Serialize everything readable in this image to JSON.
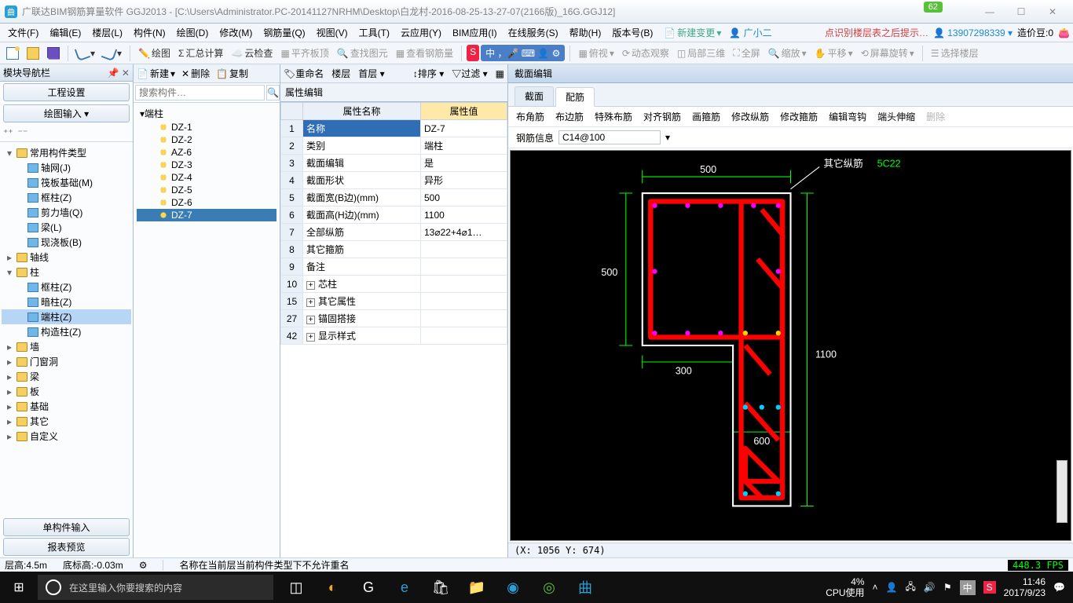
{
  "titlebar": {
    "title": "广联达BIM钢筋算量软件 GGJ2013 - [C:\\Users\\Administrator.PC-20141127NRHM\\Desktop\\白龙村-2016-08-25-13-27-07(2166版)_16G.GGJ12]",
    "badge": "62"
  },
  "menubar": {
    "items": [
      "文件(F)",
      "编辑(E)",
      "楼层(L)",
      "构件(N)",
      "绘图(D)",
      "修改(M)",
      "钢筋量(Q)",
      "视图(V)",
      "工具(T)",
      "云应用(Y)",
      "BIM应用(I)",
      "在线服务(S)",
      "帮助(H)",
      "版本号(B)"
    ],
    "new_change": "新建变更",
    "user_name": "广小二",
    "promo": "点识别楼层表之后提示…",
    "account": "13907298339",
    "credit_label": "造价豆:0"
  },
  "toolbar2": {
    "items": [
      "绘图",
      "汇总计算",
      "云检查",
      "平齐板顶",
      "查找图元",
      "查看钢筋量",
      "",
      "俯视",
      "动态观察",
      "局部三维",
      "全屏",
      "缩放",
      "平移",
      "屏幕旋转",
      "选择楼层"
    ]
  },
  "left_panel": {
    "title": "模块导航栏",
    "tabs": [
      "工程设置",
      "绘图输入"
    ],
    "tree": [
      {
        "l": 1,
        "exp": "▾",
        "ico": "folder",
        "label": "常用构件类型"
      },
      {
        "l": 2,
        "ico": "item",
        "label": "轴网(J)"
      },
      {
        "l": 2,
        "ico": "item",
        "label": "筏板基础(M)"
      },
      {
        "l": 2,
        "ico": "item",
        "label": "框柱(Z)"
      },
      {
        "l": 2,
        "ico": "item",
        "label": "剪力墙(Q)"
      },
      {
        "l": 2,
        "ico": "item",
        "label": "梁(L)"
      },
      {
        "l": 2,
        "ico": "item",
        "label": "现浇板(B)"
      },
      {
        "l": 1,
        "exp": "▸",
        "ico": "folder",
        "label": "轴线"
      },
      {
        "l": 1,
        "exp": "▾",
        "ico": "folder",
        "label": "柱"
      },
      {
        "l": 2,
        "ico": "item",
        "label": "框柱(Z)"
      },
      {
        "l": 2,
        "ico": "item",
        "label": "暗柱(Z)"
      },
      {
        "l": 2,
        "ico": "item",
        "label": "端柱(Z)",
        "selected": true
      },
      {
        "l": 2,
        "ico": "item",
        "label": "构造柱(Z)"
      },
      {
        "l": 1,
        "exp": "▸",
        "ico": "folder",
        "label": "墙"
      },
      {
        "l": 1,
        "exp": "▸",
        "ico": "folder",
        "label": "门窗洞"
      },
      {
        "l": 1,
        "exp": "▸",
        "ico": "folder",
        "label": "梁"
      },
      {
        "l": 1,
        "exp": "▸",
        "ico": "folder",
        "label": "板"
      },
      {
        "l": 1,
        "exp": "▸",
        "ico": "folder",
        "label": "基础"
      },
      {
        "l": 1,
        "exp": "▸",
        "ico": "folder",
        "label": "其它"
      },
      {
        "l": 1,
        "exp": "▸",
        "ico": "folder",
        "label": "自定义"
      }
    ],
    "bottom_tabs": [
      "单构件输入",
      "报表预览"
    ]
  },
  "mid_panel": {
    "toolbar": [
      "新建",
      "删除",
      "复制",
      "重命名",
      "楼层",
      "首层"
    ],
    "search_placeholder": "搜索构件…",
    "tree": [
      {
        "l": 1,
        "exp": "▾",
        "label": "端柱"
      },
      {
        "l": 2,
        "label": "DZ-1"
      },
      {
        "l": 2,
        "label": "DZ-2"
      },
      {
        "l": 2,
        "label": "AZ-6"
      },
      {
        "l": 2,
        "label": "DZ-3"
      },
      {
        "l": 2,
        "label": "DZ-4"
      },
      {
        "l": 2,
        "label": "DZ-5"
      },
      {
        "l": 2,
        "label": "DZ-6"
      },
      {
        "l": 2,
        "label": "DZ-7",
        "selected": true
      }
    ]
  },
  "prop_panel": {
    "title": "属性编辑",
    "toolbar": [
      "排序",
      "过滤"
    ],
    "headers": {
      "name": "属性名称",
      "value": "属性值"
    },
    "rows": [
      {
        "n": "1",
        "name": "名称",
        "value": "DZ-7",
        "selected": true
      },
      {
        "n": "2",
        "name": "类别",
        "value": "端柱"
      },
      {
        "n": "3",
        "name": "截面编辑",
        "value": "是"
      },
      {
        "n": "4",
        "name": "截面形状",
        "value": "异形"
      },
      {
        "n": "5",
        "name": "截面宽(B边)(mm)",
        "value": "500"
      },
      {
        "n": "6",
        "name": "截面高(H边)(mm)",
        "value": "1100"
      },
      {
        "n": "7",
        "name": "全部纵筋",
        "value": "13⌀22+4⌀1…"
      },
      {
        "n": "8",
        "name": "其它箍筋",
        "value": ""
      },
      {
        "n": "9",
        "name": "备注",
        "value": ""
      },
      {
        "n": "10",
        "name": "芯柱",
        "value": "",
        "exp": "+"
      },
      {
        "n": "15",
        "name": "其它属性",
        "value": "",
        "exp": "+"
      },
      {
        "n": "27",
        "name": "锚固搭接",
        "value": "",
        "exp": "+"
      },
      {
        "n": "42",
        "name": "显示样式",
        "value": "",
        "exp": "+"
      }
    ]
  },
  "right_panel": {
    "title": "截面编辑",
    "tabs": [
      {
        "label": "截面"
      },
      {
        "label": "配筋",
        "active": true
      }
    ],
    "toolbar": [
      "布角筋",
      "布边筋",
      "特殊布筋",
      "对齐钢筋",
      "画箍筋",
      "修改纵筋",
      "修改箍筋",
      "编辑弯钩",
      "端头伸缩"
    ],
    "toolbar_disabled": "删除",
    "input_label": "钢筋信息",
    "input_value": "C14@100",
    "annotation1": "其它纵筋",
    "annotation2": "5C22",
    "dims": {
      "top": "500",
      "left": "500",
      "mid": "300",
      "rightH": "1100",
      "bottom": "600"
    },
    "coords": "(X: 1056 Y: 674)"
  },
  "statusbar": {
    "floor_h": "层高:4.5m",
    "bottom_h": "底标高:-0.03m",
    "msg": "名称在当前层当前构件类型下不允许重名",
    "fps": "448.3 FPS"
  },
  "taskbar": {
    "search_placeholder": "在这里输入你要搜索的内容",
    "cpu_pct": "4%",
    "cpu_label": "CPU使用",
    "ime": "中",
    "time": "11:46",
    "date": "2017/9/23"
  }
}
